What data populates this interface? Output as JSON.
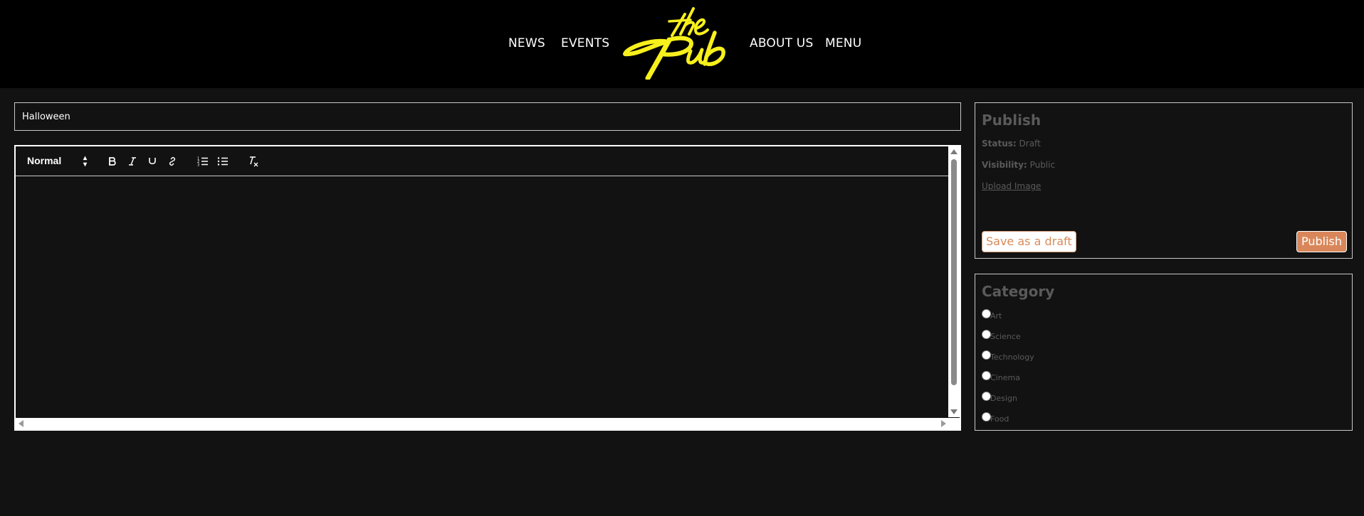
{
  "nav": {
    "links": [
      "NEWS",
      "EVENTS",
      "ABOUT US",
      "MENU"
    ],
    "logo_text": "the Pub",
    "logo_color": "#f7f01c"
  },
  "post": {
    "title_value": "Halloween"
  },
  "editor": {
    "format_select": "Normal",
    "tools": [
      "bold-icon",
      "italic-icon",
      "underline-icon",
      "link-icon",
      "ordered-list-icon",
      "bullet-list-icon",
      "clear-format-icon"
    ],
    "content": ""
  },
  "publish": {
    "heading": "Publish",
    "status_label": "Status:",
    "status_value": "Draft",
    "visibility_label": "Visibility:",
    "visibility_value": "Public",
    "upload_label": "Upload Image",
    "draft_button": "Save as a draft",
    "publish_button": "Publish",
    "accent_color": "#d9875a"
  },
  "category": {
    "heading": "Category",
    "options": [
      "Art",
      "Science",
      "Technology",
      "Cinema",
      "Design",
      "Food"
    ]
  }
}
